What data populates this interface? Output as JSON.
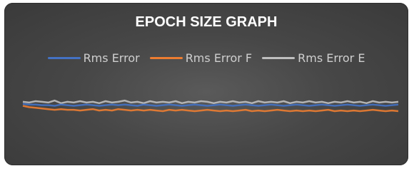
{
  "chart_data": {
    "type": "line",
    "title": "EPOCH SIZE GRAPH",
    "xlabel": "",
    "ylabel": "",
    "legend_position": "top",
    "grid": false,
    "series": [
      {
        "name": "Rms Error",
        "color": "#4472C4",
        "values": [
          0.71,
          0.7,
          0.7,
          0.69,
          0.69,
          0.68,
          0.7,
          0.69,
          0.68,
          0.69,
          0.7,
          0.69,
          0.68,
          0.69,
          0.7,
          0.69,
          0.7,
          0.69,
          0.68,
          0.7,
          0.69,
          0.68,
          0.69,
          0.7,
          0.69,
          0.68,
          0.69,
          0.7,
          0.69,
          0.68,
          0.69,
          0.7,
          0.69,
          0.68,
          0.69,
          0.7,
          0.69,
          0.68,
          0.69,
          0.7,
          0.69,
          0.68,
          0.69,
          0.7,
          0.69,
          0.68,
          0.69,
          0.7,
          0.69,
          0.68,
          0.69,
          0.7,
          0.69,
          0.68,
          0.69,
          0.7,
          0.69,
          0.68,
          0.69,
          0.7
        ]
      },
      {
        "name": "Rms Error F",
        "color": "#ED7D31",
        "values": [
          0.68,
          0.66,
          0.65,
          0.64,
          0.63,
          0.62,
          0.63,
          0.62,
          0.62,
          0.61,
          0.62,
          0.63,
          0.61,
          0.62,
          0.61,
          0.63,
          0.62,
          0.61,
          0.62,
          0.61,
          0.62,
          0.61,
          0.6,
          0.62,
          0.61,
          0.62,
          0.61,
          0.6,
          0.61,
          0.62,
          0.61,
          0.6,
          0.61,
          0.6,
          0.61,
          0.62,
          0.6,
          0.61,
          0.6,
          0.61,
          0.62,
          0.61,
          0.6,
          0.61,
          0.6,
          0.61,
          0.6,
          0.61,
          0.62,
          0.6,
          0.61,
          0.6,
          0.61,
          0.6,
          0.61,
          0.62,
          0.61,
          0.6,
          0.61,
          0.6
        ]
      },
      {
        "name": "Rms Error E",
        "color": "#BFBFBF",
        "values": [
          0.74,
          0.73,
          0.75,
          0.74,
          0.73,
          0.76,
          0.72,
          0.74,
          0.73,
          0.75,
          0.73,
          0.74,
          0.72,
          0.75,
          0.73,
          0.74,
          0.76,
          0.73,
          0.74,
          0.72,
          0.75,
          0.73,
          0.74,
          0.73,
          0.75,
          0.72,
          0.74,
          0.73,
          0.75,
          0.74,
          0.72,
          0.74,
          0.73,
          0.75,
          0.73,
          0.74,
          0.72,
          0.75,
          0.73,
          0.74,
          0.73,
          0.75,
          0.72,
          0.74,
          0.73,
          0.75,
          0.73,
          0.74,
          0.72,
          0.74,
          0.73,
          0.75,
          0.73,
          0.74,
          0.72,
          0.75,
          0.73,
          0.74,
          0.73,
          0.74
        ]
      }
    ],
    "ylim": [
      0,
      1.2
    ]
  }
}
